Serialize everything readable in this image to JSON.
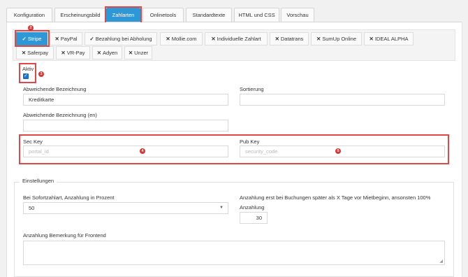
{
  "top_tabs": [
    "Konfiguration",
    "Erscheinungsbild",
    "Zahlarten",
    "Onlinetools",
    "Standardtexte",
    "HTML und CSS",
    "Vorschau"
  ],
  "payment_tabs": [
    {
      "mark": "✓",
      "label": "Stripe"
    },
    {
      "mark": "✕",
      "label": "PayPal"
    },
    {
      "mark": "✓",
      "label": "Bezahlung bei Abholung"
    },
    {
      "mark": "✕",
      "label": "Mollie.com"
    },
    {
      "mark": "✕",
      "label": "Individuelle Zahlart"
    },
    {
      "mark": "✕",
      "label": "Datatrans"
    },
    {
      "mark": "✕",
      "label": "SumUp Online"
    },
    {
      "mark": "✕",
      "label": "IDEAL ALPHA"
    },
    {
      "mark": "✕",
      "label": "Saferpay"
    },
    {
      "mark": "✕",
      "label": "VR-Pay"
    },
    {
      "mark": "✕",
      "label": "Adyen"
    },
    {
      "mark": "✕",
      "label": "Unzer"
    }
  ],
  "form": {
    "aktiv_label": "Aktiv",
    "abw_bez_label": "Abweichende Bezeichnung",
    "abw_bez_value": "Kreditkarte",
    "sortierung_label": "Sortierung",
    "sortierung_value": "",
    "abw_bez_en_label": "Abweichende Bezeichnung (en)",
    "abw_bez_en_value": "",
    "sec_key_label": "Sec Key",
    "sec_key_placeholder": "portal_id",
    "pub_key_label": "Pub Key",
    "pub_key_placeholder": "security_code"
  },
  "settings": {
    "legend": "Einstellungen",
    "anzahlung_label": "Bei Sofortzahlart, Anzahlung in Prozent",
    "anzahlung_value": "50",
    "days_label": "Anzahlung erst bei Buchungen später als X Tage vor Mietbeginn, ansonsten 100%",
    "days_sub_label": "Anzahlung",
    "days_value": "30",
    "bemerkung_label": "Anzahlung Bemerkung für Frontend"
  },
  "badges": [
    "1",
    "2",
    "3",
    "4",
    "5"
  ],
  "colors": {
    "accent": "#2e98d6",
    "highlight": "#e04848",
    "badge": "#d93636"
  }
}
